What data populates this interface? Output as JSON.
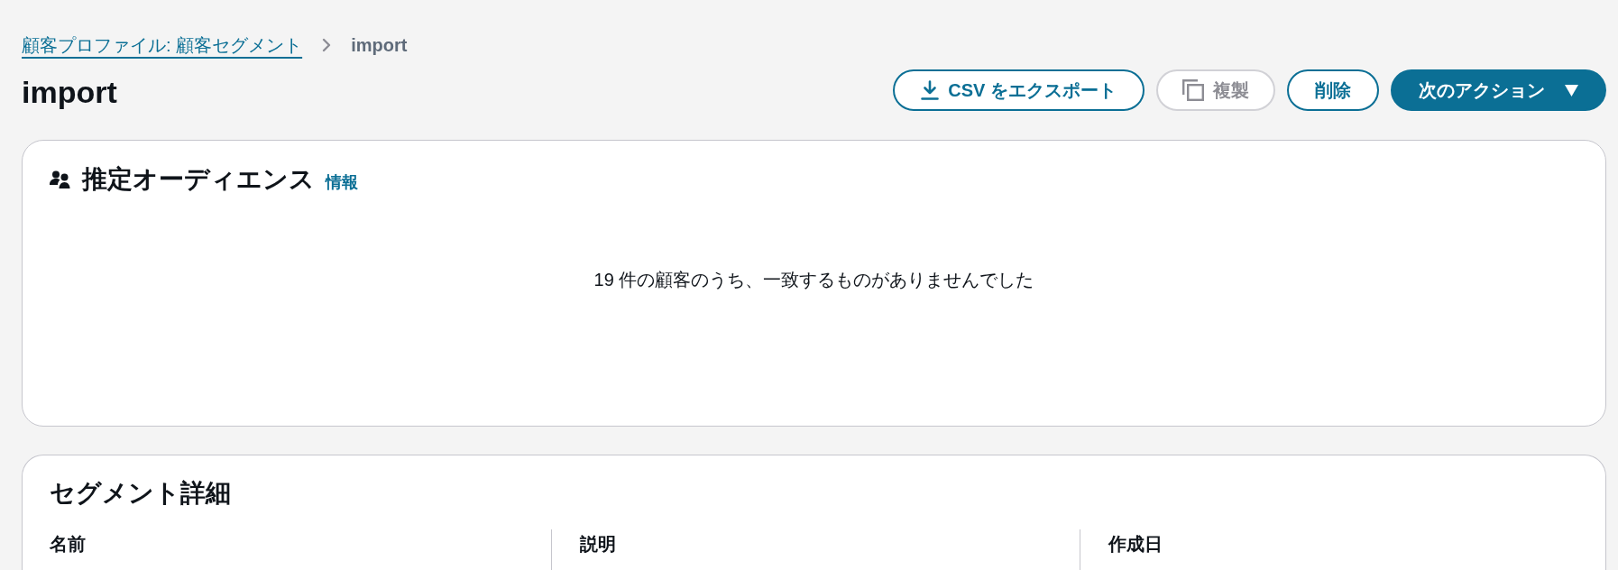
{
  "breadcrumbs": [
    {
      "label": "顧客プロファイル: 顧客セグメント",
      "kind": "link"
    },
    {
      "label": "import",
      "kind": "current"
    }
  ],
  "page": {
    "title": "import"
  },
  "actions": [
    {
      "label": "CSV をエクスポート",
      "kind": "export",
      "disabled": false
    },
    {
      "label": "複製",
      "kind": "duplicate",
      "disabled": true
    },
    {
      "label": "削除",
      "kind": "delete",
      "disabled": false
    },
    {
      "label": "次のアクション",
      "kind": "menu",
      "disabled": false
    }
  ],
  "audience_card": {
    "title": "推定オーディエンス",
    "info_link": "情報",
    "message": "19 件の顧客のうち、一致するものがありませんでした"
  },
  "details_card": {
    "title": "セグメント詳細",
    "columns": [
      "名前",
      "説明",
      "作成日"
    ]
  }
}
